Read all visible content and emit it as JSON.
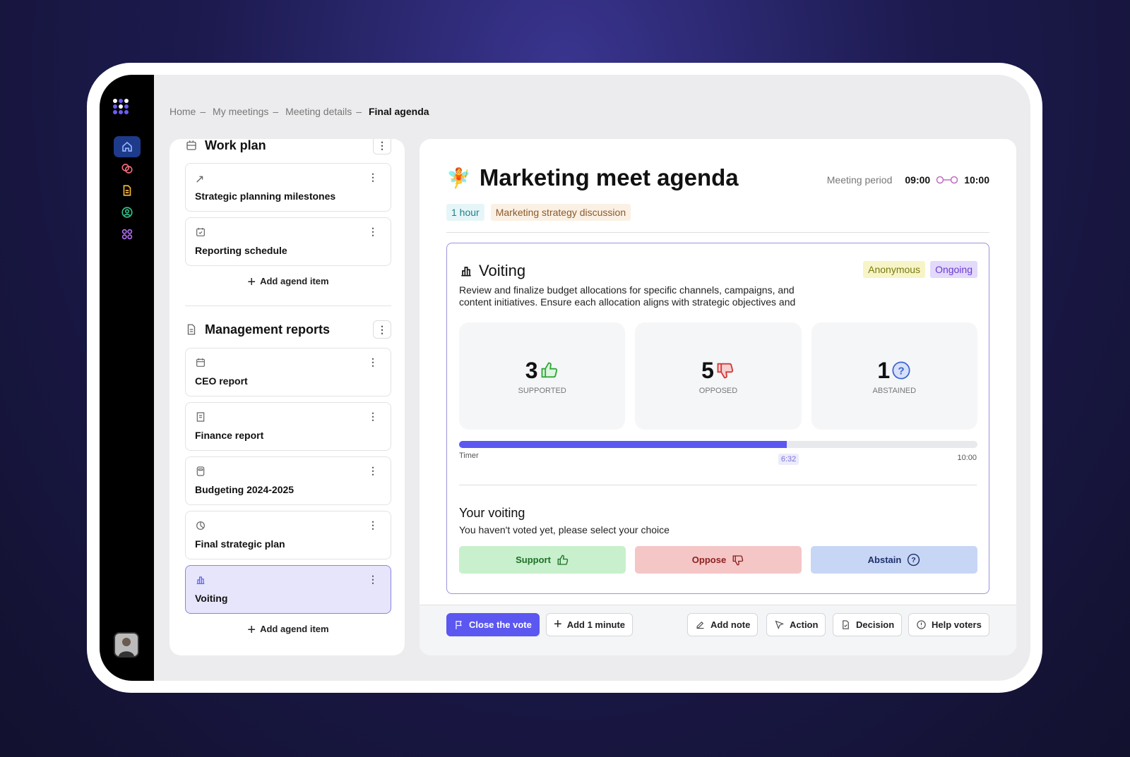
{
  "breadcrumb": [
    "Home",
    "My meetings",
    "Meeting details",
    "Final agenda"
  ],
  "breadcrumb_sep": "–",
  "sidebar": {
    "items": [
      {
        "icon": "home-icon",
        "color": "#93b4ff"
      },
      {
        "icon": "chat-icon",
        "color": "#f06a7a"
      },
      {
        "icon": "document-icon",
        "color": "#f5b83d"
      },
      {
        "icon": "user-circle-icon",
        "color": "#34c38f"
      },
      {
        "icon": "apps-icon",
        "color": "#b06cf0"
      }
    ]
  },
  "agenda": {
    "sections": [
      {
        "title": "Work plan",
        "items": [
          {
            "label": "Strategic planning milestones",
            "icon": "trending-icon"
          },
          {
            "label": "Reporting schedule",
            "icon": "calendar-check-icon"
          }
        ]
      },
      {
        "title": "Management reports",
        "items": [
          {
            "label": "CEO report",
            "icon": "calendar-icon"
          },
          {
            "label": "Finance report",
            "icon": "receipt-icon"
          },
          {
            "label": "Budgeting 2024-2025",
            "icon": "calculator-icon"
          },
          {
            "label": "Final strategic plan",
            "icon": "pie-chart-icon"
          },
          {
            "label": "Voiting",
            "icon": "bar-chart-icon",
            "selected": true
          }
        ]
      }
    ],
    "add_label": "Add agend item"
  },
  "meeting": {
    "title": "Marketing meet agenda",
    "period_label": "Meeting period",
    "start": "09:00",
    "end": "10:00",
    "duration": "1 hour",
    "topic": "Marketing strategy discussion"
  },
  "voting": {
    "title": "Voiting",
    "badges": [
      "Anonymous",
      "Ongoing"
    ],
    "description": "Review and finalize budget allocations for specific channels, campaigns, and content initiatives. Ensure each allocation aligns with strategic objectives and",
    "stats": [
      {
        "count": "3",
        "label": "SUPPORTED"
      },
      {
        "count": "5",
        "label": "OPPOSED"
      },
      {
        "count": "1",
        "label": "ABSTAINED"
      }
    ],
    "timer": {
      "label": "Timer",
      "current": "6:32",
      "total": "10:00",
      "progress": 0.632
    },
    "your_title": "Your voiting",
    "status_bold": "You haven't voted yet,",
    "status_rest": " please select your choice",
    "buttons": [
      "Support",
      "Oppose",
      "Abstain"
    ],
    "colors": {
      "accent": "#5b57f0",
      "support": "#c8f0cc",
      "oppose": "#f5c6c6",
      "abstain": "#c8d6f5"
    }
  },
  "footer": {
    "close": "Close the vote",
    "add_minute": "Add 1 minute",
    "add_note": "Add note",
    "action": "Action",
    "decision": "Decision",
    "help": "Help voters"
  }
}
